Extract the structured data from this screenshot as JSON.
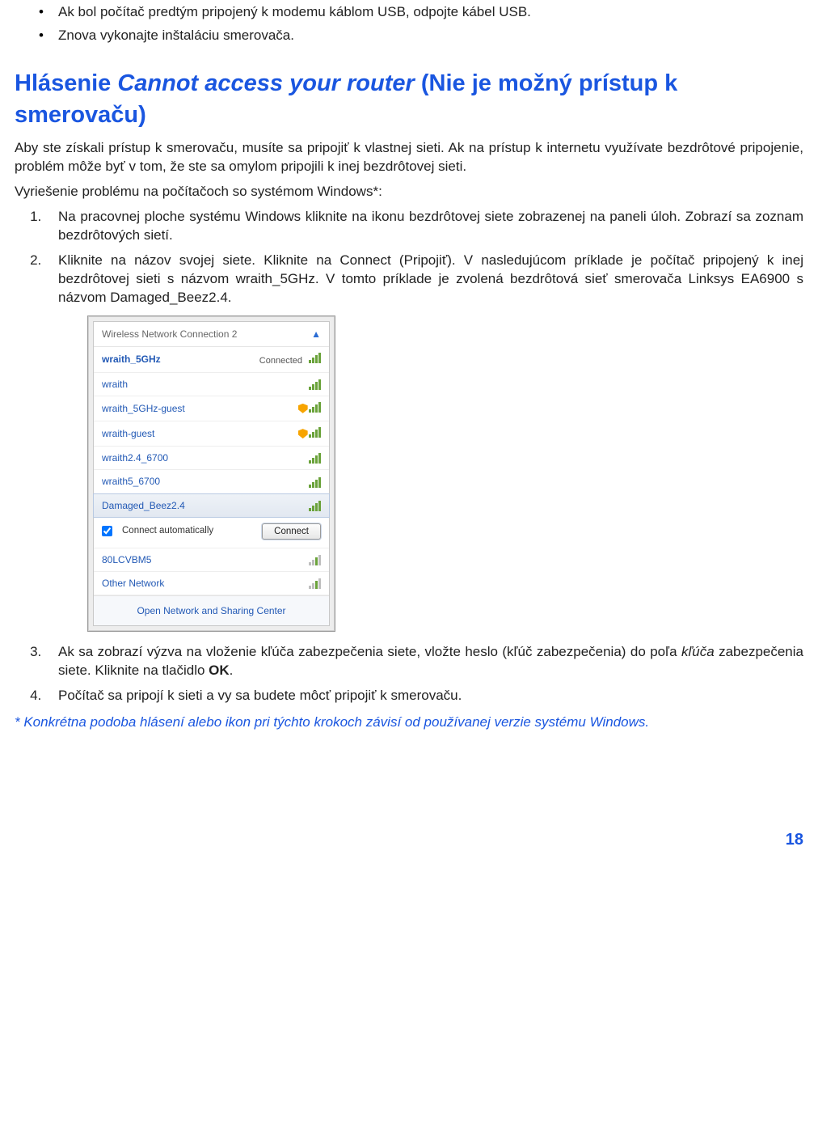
{
  "top_bullets": [
    "Ak bol počítač predtým pripojený k modemu káblom USB, odpojte kábel USB.",
    "Znova vykonajte inštaláciu smerovača."
  ],
  "heading": {
    "prefix": "Hlásenie ",
    "italic": "Cannot access your router",
    "suffix": " (Nie je možný prístup k smerovaču)"
  },
  "para1": "Aby ste získali prístup k smerovaču, musíte sa pripojiť k vlastnej sieti. Ak na prístup k internetu využívate bezdrôtové pripojenie, problém môže byť v tom, že ste sa omylom pripojili k inej bezdrôtovej sieti.",
  "para2": "Vyriešenie problému na počítačoch so systémom Windows*:",
  "steps": {
    "s1": "Na pracovnej ploche systému Windows kliknite na ikonu bezdrôtovej siete zobrazenej na paneli úloh. Zobrazí sa zoznam bezdrôtových sietí.",
    "s2": "Kliknite na názov svojej siete. Kliknite na Connect (Pripojiť). V nasledujúcom príklade je počítač pripojený k inej bezdrôtovej sieti s názvom wraith_5GHz. V tomto príklade je zvolená bezdrôtová sieť smerovača Linksys EA6900 s názvom Damaged_Beez2.4.",
    "s3_pre": "Ak sa zobrazí výzva na vloženie kľúča zabezpečenia siete, vložte heslo (kľúč zabezpečenia) do poľa ",
    "s3_italic": "kľúča",
    "s3_mid": " zabezpečenia siete. Kliknite na tlačidlo ",
    "s3_bold": "OK",
    "s3_post": ".",
    "s4": "Počítač sa pripojí k sieti a vy sa budete môcť pripojiť k smerovaču."
  },
  "footnote": "* Konkrétna podoba hlásení alebo ikon pri týchto krokoch závisí od používanej verzie systému Windows.",
  "page_number": "18",
  "wifi": {
    "header": "Wireless Network Connection 2",
    "rows": [
      {
        "name": "wraith_5GHz",
        "status": "Connected",
        "shield": false,
        "strong": true
      },
      {
        "name": "wraith",
        "status": "",
        "shield": false,
        "strong": true
      },
      {
        "name": "wraith_5GHz-guest",
        "status": "",
        "shield": true,
        "strong": true
      },
      {
        "name": "wraith-guest",
        "status": "",
        "shield": true,
        "strong": true
      },
      {
        "name": "wraith2.4_6700",
        "status": "",
        "shield": false,
        "strong": true
      },
      {
        "name": "wraith5_6700",
        "status": "",
        "shield": false,
        "strong": true
      }
    ],
    "selected": {
      "name": "Damaged_Beez2.4"
    },
    "checkbox_label": "Connect automatically",
    "connect_button": "Connect",
    "extra_rows": [
      {
        "name": "80LCVBM5",
        "weak": true
      },
      {
        "name": "Other Network",
        "weak": true
      }
    ],
    "footer": "Open Network and Sharing Center"
  }
}
